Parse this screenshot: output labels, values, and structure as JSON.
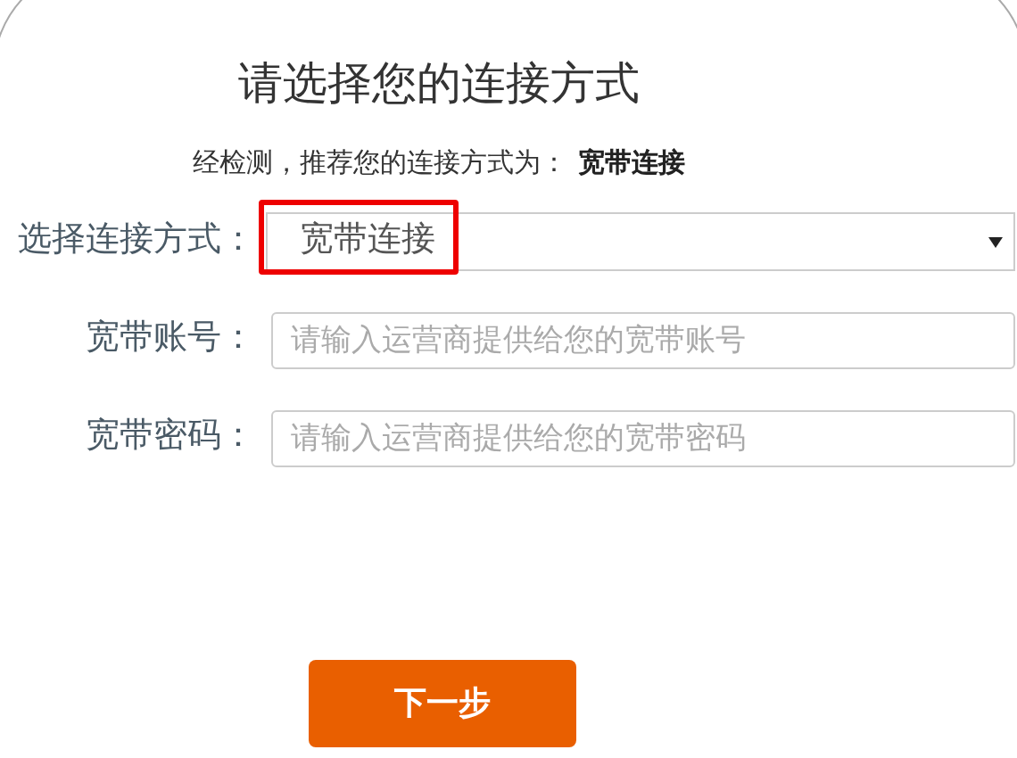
{
  "title": "请选择您的连接方式",
  "recommendation": {
    "text": "经检测，推荐您的连接方式为：",
    "value": "宽带连接"
  },
  "fields": [
    {
      "kind": "select",
      "label": "选择连接方式：",
      "value": "宽带连接",
      "highlighted": true
    },
    {
      "kind": "input",
      "label": "宽带账号：",
      "placeholder": "请输入运营商提供给您的宽带账号"
    },
    {
      "kind": "input",
      "label": "宽带密码：",
      "placeholder": "请输入运营商提供给您的宽带密码"
    }
  ],
  "next_button": "下一步"
}
